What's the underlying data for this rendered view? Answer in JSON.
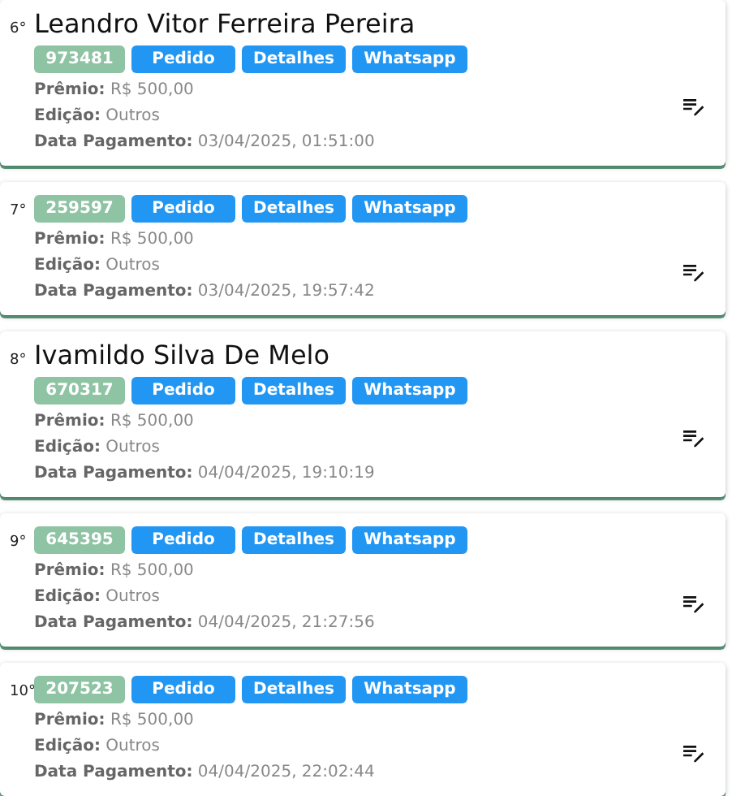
{
  "cards": [
    {
      "rank": "6°",
      "name": "Leandro Vitor Ferreira Pereira",
      "code": "973481",
      "buttons": [
        "Pedido",
        "Detalhes",
        "Whatsapp"
      ],
      "fields": [
        {
          "label": "Prêmio:",
          "value": "R$ 500,00"
        },
        {
          "label": "Edição:",
          "value": "Outros"
        },
        {
          "label": "Data Pagamento:",
          "value": "03/04/2025, 01:51:00"
        }
      ]
    },
    {
      "rank": "7°",
      "code": "259597",
      "buttons": [
        "Pedido",
        "Detalhes",
        "Whatsapp"
      ],
      "fields": [
        {
          "label": "Prêmio:",
          "value": "R$ 500,00"
        },
        {
          "label": "Edição:",
          "value": "Outros"
        },
        {
          "label": "Data Pagamento:",
          "value": "03/04/2025, 19:57:42"
        }
      ]
    },
    {
      "rank": "8°",
      "name": "Ivamildo Silva De Melo",
      "code": "670317",
      "buttons": [
        "Pedido",
        "Detalhes",
        "Whatsapp"
      ],
      "fields": [
        {
          "label": "Prêmio:",
          "value": "R$ 500,00"
        },
        {
          "label": "Edição:",
          "value": "Outros"
        },
        {
          "label": "Data Pagamento:",
          "value": "04/04/2025, 19:10:19"
        }
      ]
    },
    {
      "rank": "9°",
      "code": "645395",
      "buttons": [
        "Pedido",
        "Detalhes",
        "Whatsapp"
      ],
      "fields": [
        {
          "label": "Prêmio:",
          "value": "R$ 500,00"
        },
        {
          "label": "Edição:",
          "value": "Outros"
        },
        {
          "label": "Data Pagamento:",
          "value": "04/04/2025, 21:27:56"
        }
      ]
    },
    {
      "rank": "10°",
      "code": "207523",
      "buttons": [
        "Pedido",
        "Detalhes",
        "Whatsapp"
      ],
      "fields": [
        {
          "label": "Prêmio:",
          "value": "R$ 500,00"
        },
        {
          "label": "Edição:",
          "value": "Outros"
        },
        {
          "label": "Data Pagamento:",
          "value": "04/04/2025, 22:02:44"
        }
      ]
    }
  ]
}
